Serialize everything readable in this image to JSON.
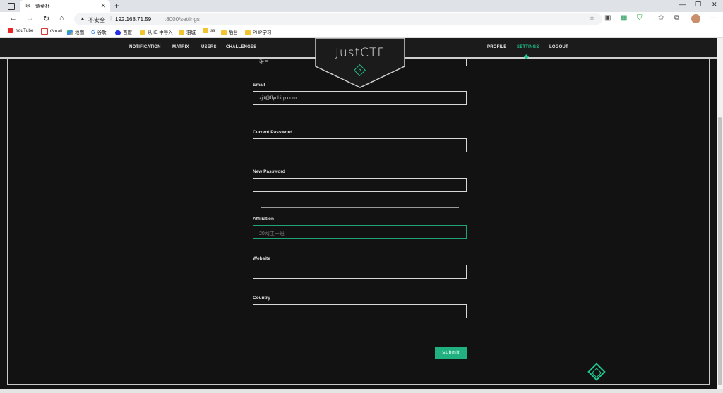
{
  "browser": {
    "tab_title": "紫金杯",
    "tab_favicon": "✻",
    "new_tab": "+",
    "security_label": "不安全",
    "url_host": "192.168.71.59",
    "url_path": ":8000/settings",
    "bookmarks": [
      "YouTube",
      "Gmail",
      "地图",
      "谷歌",
      "百度",
      "从 IE 中导入",
      "羽城",
      "ss",
      "后台",
      "PHP学习"
    ]
  },
  "nav": {
    "left": [
      "NOTIFICATION",
      "MATRIX",
      "USERS",
      "CHALLENGES"
    ],
    "right": [
      "PROFILE",
      "SETTINGS",
      "LOGOUT"
    ],
    "active": "SETTINGS",
    "logo": "JustCTF"
  },
  "form": {
    "name_value": "张三",
    "email_label": "Email",
    "email_value": "zjit@flychirp.com",
    "current_password_label": "Current Password",
    "new_password_label": "New Password",
    "affiliation_label": "Affiliation",
    "affiliation_placeholder": "20网工一班",
    "website_label": "Website",
    "country_label": "Country",
    "submit_label": "Submit"
  },
  "colors": {
    "accent": "#21c48d",
    "background": "#121212"
  }
}
